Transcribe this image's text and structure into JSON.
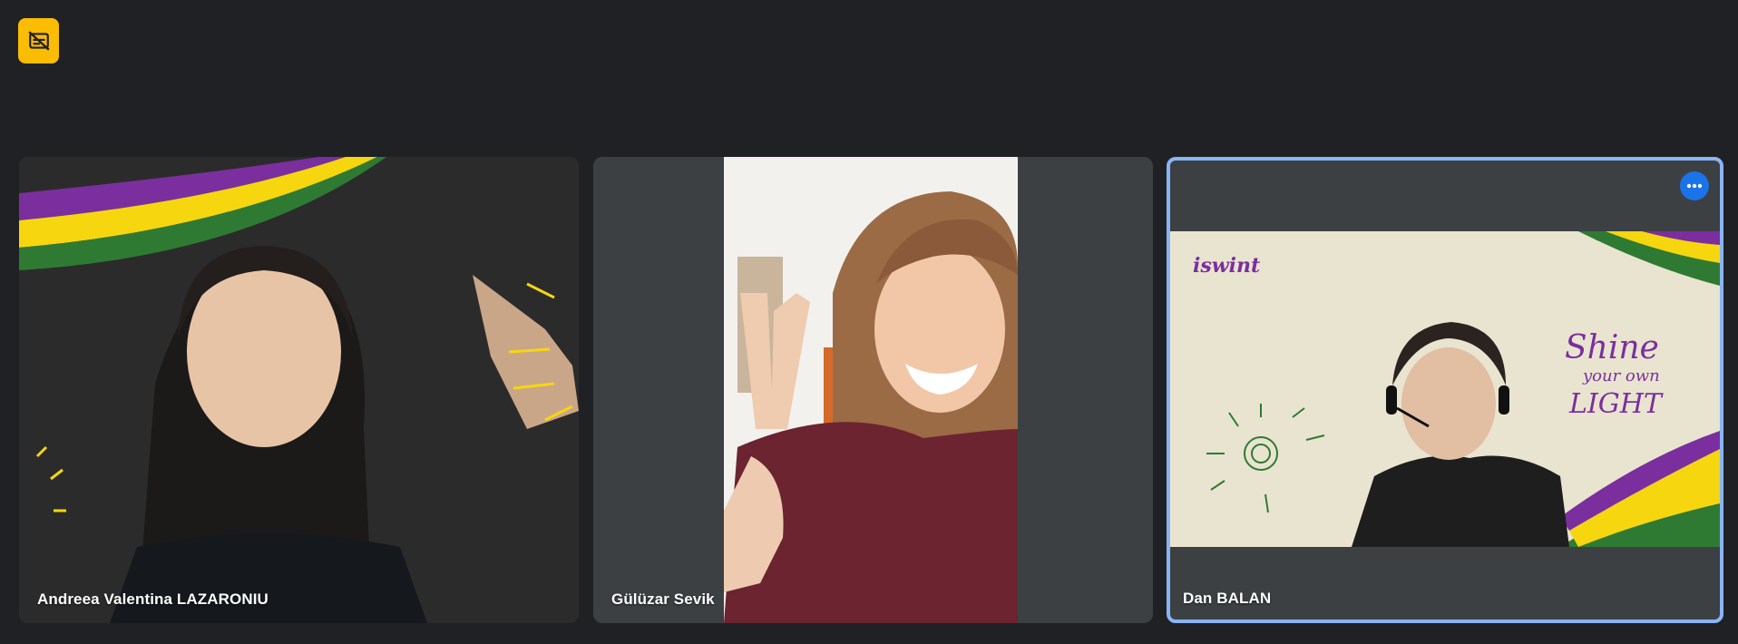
{
  "toolbar": {
    "captions_icon": "captions-off-icon",
    "accent_color": "#fbbc04"
  },
  "participants": [
    {
      "name": "Andreea Valentina LAZARONIU",
      "background": "dark chalkboard with purple, yellow and green stripes"
    },
    {
      "name": "Gülüzar Sevik",
      "background": "portrait video, letterboxed"
    },
    {
      "name": "Dan BALAN",
      "background": "beige paper with Shine your own LIGHT doodle",
      "active_speaker": true,
      "overlay_text": [
        "Shine",
        "your own",
        "LIGHT"
      ],
      "logo_text": "iswint"
    }
  ],
  "colors": {
    "page_bg": "#202124",
    "tile_bg": "#3c4043",
    "active_border": "#8ab4f8",
    "more_button": "#1a73e8"
  },
  "more_icon": "more-options-icon"
}
